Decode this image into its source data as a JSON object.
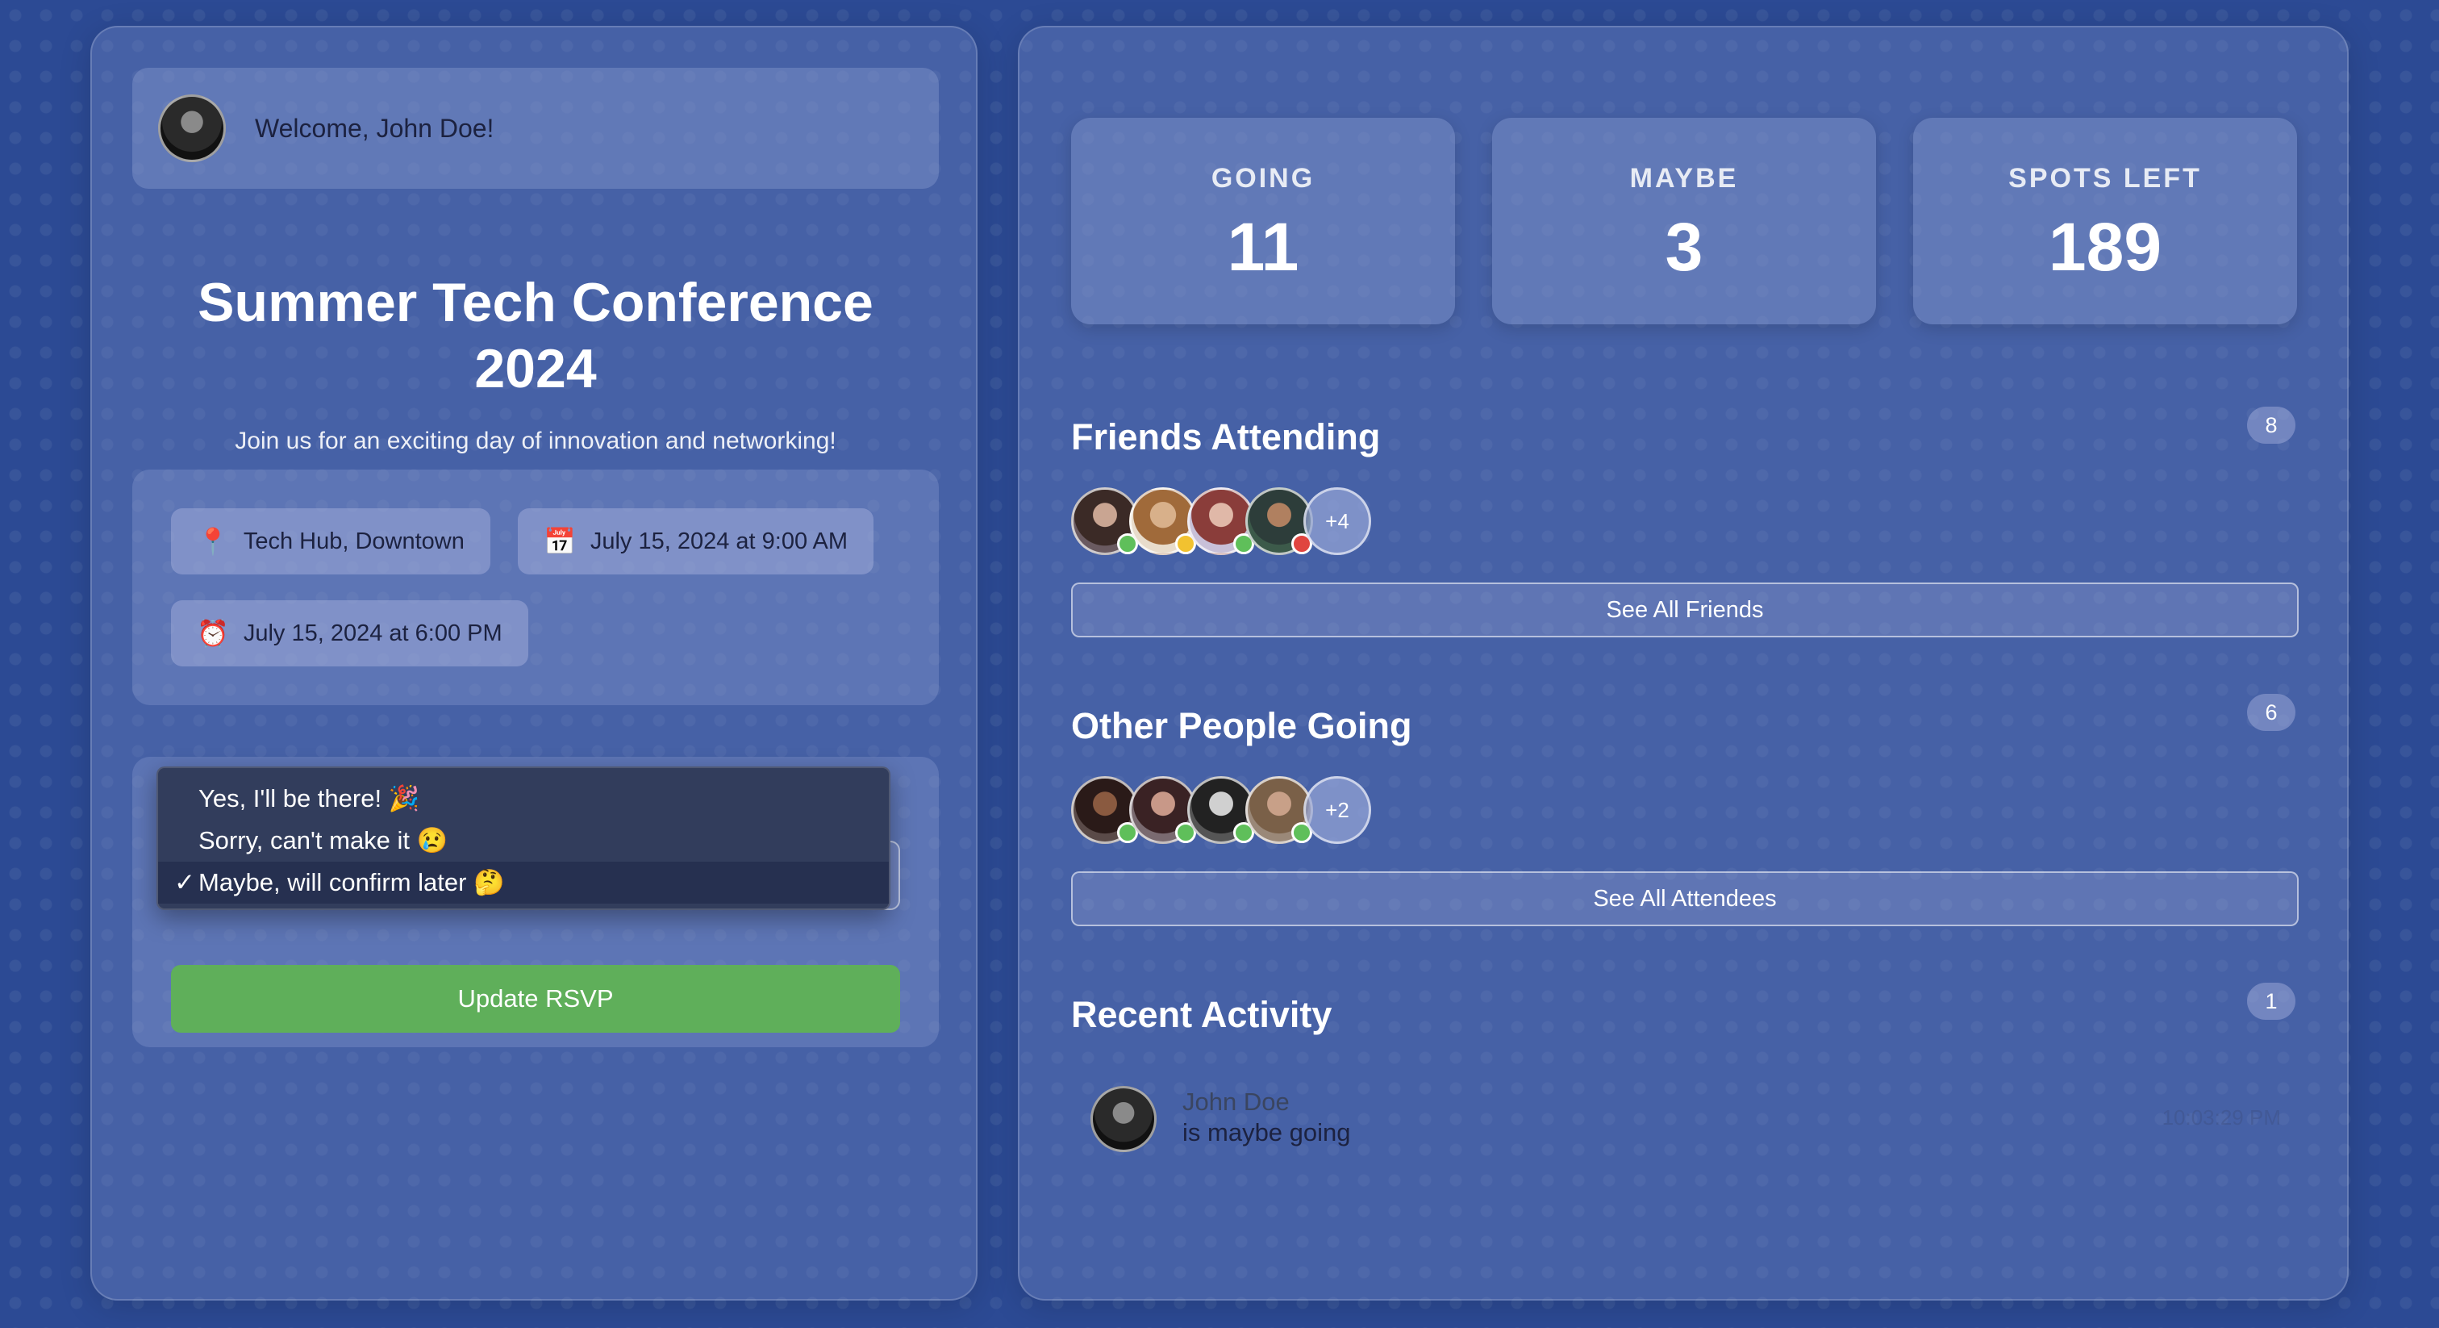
{
  "user": {
    "welcome": "Welcome, John Doe!"
  },
  "event": {
    "title": "Summer Tech Conference 2024",
    "subtitle": "Join us for an exciting day of innovation and networking!",
    "location": {
      "icon": "📍",
      "text": "Tech Hub, Downtown"
    },
    "start": {
      "icon": "📅",
      "text": "July 15, 2024 at 9:00 AM"
    },
    "end": {
      "icon": "⏰",
      "text": "July 15, 2024 at 6:00 PM"
    }
  },
  "rsvp": {
    "options": [
      {
        "label": "Yes, I'll be there! 🎉",
        "selected": false
      },
      {
        "label": "Sorry, can't make it 😢",
        "selected": false
      },
      {
        "label": "Maybe, will confirm later 🤔",
        "selected": true
      }
    ],
    "check_mark": "✓",
    "update_label": "Update RSVP"
  },
  "stats": [
    {
      "label": "GOING",
      "value": "11"
    },
    {
      "label": "MAYBE",
      "value": "3"
    },
    {
      "label": "SPOTS LEFT",
      "value": "189"
    }
  ],
  "friends": {
    "title": "Friends Attending",
    "count": "8",
    "more": "+4",
    "button": "See All Friends",
    "avatars": [
      {
        "status_color": "#5fbf5a"
      },
      {
        "status_color": "#f2c230"
      },
      {
        "status_color": "#5fbf5a"
      },
      {
        "status_color": "#e0453f"
      }
    ]
  },
  "others": {
    "title": "Other People Going",
    "count": "6",
    "more": "+2",
    "button": "See All Attendees",
    "avatars": [
      {
        "status_color": "#5fbf5a"
      },
      {
        "status_color": "#5fbf5a"
      },
      {
        "status_color": "#5fbf5a"
      },
      {
        "status_color": "#5fbf5a"
      }
    ]
  },
  "activity": {
    "title": "Recent Activity",
    "count": "1",
    "items": [
      {
        "name": "John Doe",
        "text": "is maybe going",
        "time": "10:03:29 PM"
      }
    ]
  },
  "colors": {
    "accent_green": "#5faf5a",
    "background": "#2c4a94"
  }
}
